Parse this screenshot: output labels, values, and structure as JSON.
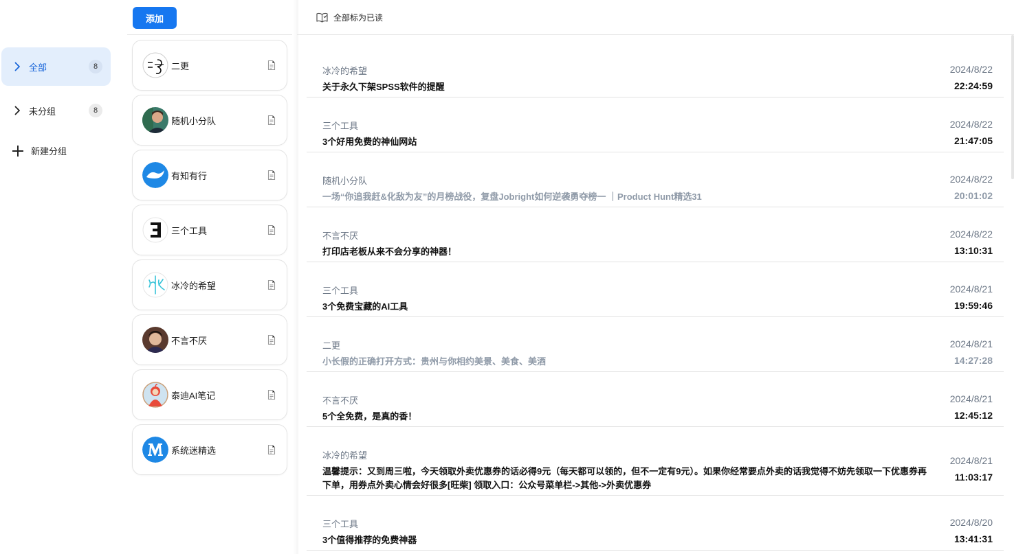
{
  "sidebar": {
    "groups": [
      {
        "label": "全部",
        "count": "8"
      },
      {
        "label": "未分组",
        "count": "8"
      }
    ],
    "new_group_label": "新建分组"
  },
  "sources": {
    "add_label": "添加",
    "items": [
      {
        "name": "二更",
        "avatar": "ergeng-logo"
      },
      {
        "name": "随机小分队",
        "avatar": "portrait-avatar"
      },
      {
        "name": "有知有行",
        "avatar": "youzhi-logo"
      },
      {
        "name": "三个工具",
        "avatar": "sange-logo"
      },
      {
        "name": "冰冷的希望",
        "avatar": "bingleng-logo"
      },
      {
        "name": "不言不厌",
        "avatar": "portrait-avatar"
      },
      {
        "name": "泰迪AI笔记",
        "avatar": "teletubby-avatar"
      },
      {
        "name": "系统迷精选",
        "avatar": "m-logo"
      }
    ]
  },
  "toolbar": {
    "mark_all_read": "全部标为已读"
  },
  "articles": [
    {
      "source": "冰冷的希望",
      "title": "关于永久下架SPSS软件的提醒",
      "date": "2024/8/22",
      "time": "22:24:59",
      "read": false
    },
    {
      "source": "三个工具",
      "title": "3个好用免费的神仙网站",
      "date": "2024/8/22",
      "time": "21:47:05",
      "read": false
    },
    {
      "source": "随机小分队",
      "title": "一场“你追我赶&化敌为友”的月榜战役，复盘Jobright如何逆袭勇夺榜一 ｜Product Hunt精选31",
      "date": "2024/8/22",
      "time": "20:01:02",
      "read": true
    },
    {
      "source": "不言不厌",
      "title": "打印店老板从来不会分享的神器！",
      "date": "2024/8/22",
      "time": "13:10:31",
      "read": false
    },
    {
      "source": "三个工具",
      "title": "3个免费宝藏的AI工具",
      "date": "2024/8/21",
      "time": "19:59:46",
      "read": false
    },
    {
      "source": "二更",
      "title": "小长假的正确打开方式：贵州与你相约美景、美食、美酒",
      "date": "2024/8/21",
      "time": "14:27:28",
      "read": true
    },
    {
      "source": "不言不厌",
      "title": "5个全免费，是真的香！",
      "date": "2024/8/21",
      "time": "12:45:12",
      "read": false
    },
    {
      "source": "冰冷的希望",
      "title": "温馨提示：又到周三啦，今天领取外卖优惠券的话必得9元（每天都可以领的，但不一定有9元）。如果你经常要点外卖的话我觉得不妨先领取一下优惠券再下单，用券点外卖心情会好很多[旺柴] 领取入口：公众号菜单栏->其他->外卖优惠券",
      "date": "2024/8/21",
      "time": "11:03:17",
      "read": false
    },
    {
      "source": "三个工具",
      "title": "3个值得推荐的免费神器",
      "date": "2024/8/20",
      "time": "13:41:31",
      "read": false
    }
  ],
  "colors": {
    "accent": "#1677f0",
    "active_bg": "#e3eefc",
    "muted_text": "#6b7685",
    "read_text": "#8f9aa8"
  }
}
